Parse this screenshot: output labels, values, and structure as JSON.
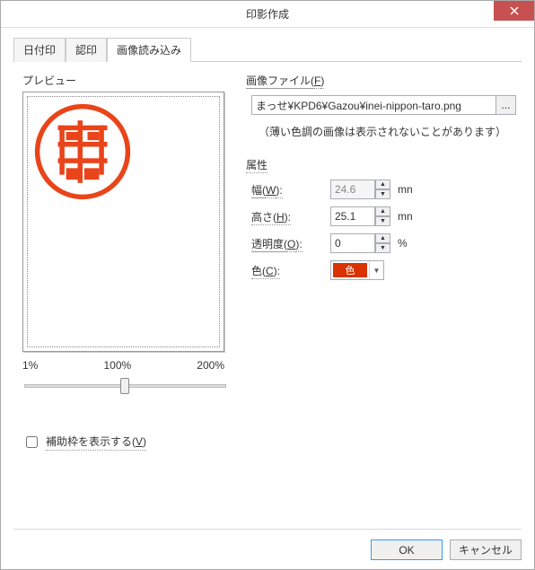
{
  "title": "印影作成",
  "tabs": {
    "date": "日付印",
    "approval": "認印",
    "image": "画像読み込み"
  },
  "preview": {
    "label": "プレビュー",
    "slider": {
      "min_label": "1%",
      "mid_label": "100%",
      "max_label": "200%",
      "value": 100
    }
  },
  "file": {
    "group_label": "画像ファイル(",
    "group_key": "F",
    "group_close": ")",
    "path": "まっせ¥KPD6¥Gazou¥inei-nippon-taro.png",
    "browse": "...",
    "hint": "（薄い色調の画像は表示されないことがあります）"
  },
  "attrs": {
    "group_label": "属性",
    "width": {
      "label": "幅(",
      "key": "W",
      "close": "):",
      "value": "24.6",
      "unit": "mn"
    },
    "height": {
      "label": "高さ(",
      "key": "H",
      "close": "):",
      "value": "25.1",
      "unit": "mn"
    },
    "opacity": {
      "label": "透明度(",
      "key": "O",
      "close": "):",
      "value": "0",
      "unit": "%"
    },
    "color": {
      "label": "色(",
      "key": "C",
      "close": "):",
      "swatch_text": "色",
      "swatch_hex": "#d93400"
    }
  },
  "guide": {
    "label": "補助枠を表示する(",
    "key": "V",
    "close": ")",
    "checked": false
  },
  "buttons": {
    "ok": "OK",
    "cancel": "キャンセル"
  }
}
